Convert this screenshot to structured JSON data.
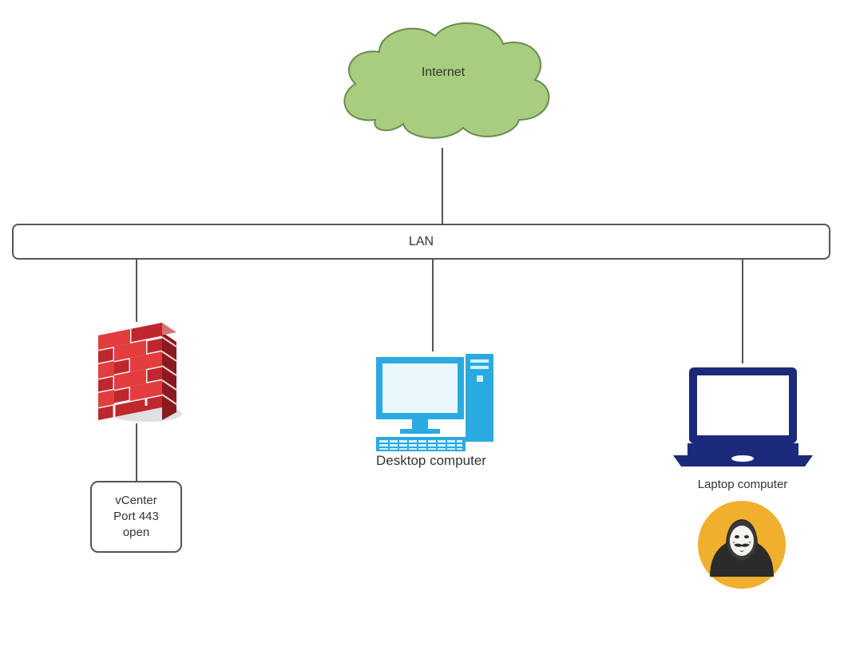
{
  "diagram": {
    "cloud_label": "Internet",
    "lan_label": "LAN",
    "desktop_label": "Desktop computer",
    "laptop_label": "Laptop computer",
    "vcenter_text": "vCenter\nPort 443\nopen"
  },
  "nodes": [
    {
      "id": "internet",
      "type": "cloud",
      "label": "Internet"
    },
    {
      "id": "lan",
      "type": "bus-bar",
      "label": "LAN"
    },
    {
      "id": "firewall",
      "type": "firewall-icon",
      "label": ""
    },
    {
      "id": "vcenter",
      "type": "box",
      "label": "vCenter Port 443 open"
    },
    {
      "id": "desktop",
      "type": "desktop-icon",
      "label": "Desktop computer"
    },
    {
      "id": "laptop",
      "type": "laptop-icon",
      "label": "Laptop computer"
    },
    {
      "id": "hacker",
      "type": "anonymous-icon",
      "label": ""
    }
  ],
  "edges": [
    [
      "internet",
      "lan"
    ],
    [
      "lan",
      "firewall"
    ],
    [
      "lan",
      "desktop"
    ],
    [
      "lan",
      "laptop"
    ],
    [
      "firewall",
      "vcenter"
    ]
  ],
  "colors": {
    "cloud_fill": "#a9cd7e",
    "cloud_stroke": "#6a8b4f",
    "firewall_red": "#c0262d",
    "firewall_red_light": "#e43d3d",
    "desktop_blue": "#29abe2",
    "laptop_navy": "#1b2a7a",
    "hacker_bg": "#f0b02d",
    "hacker_dark": "#2b2b2b",
    "line": "#555555"
  }
}
